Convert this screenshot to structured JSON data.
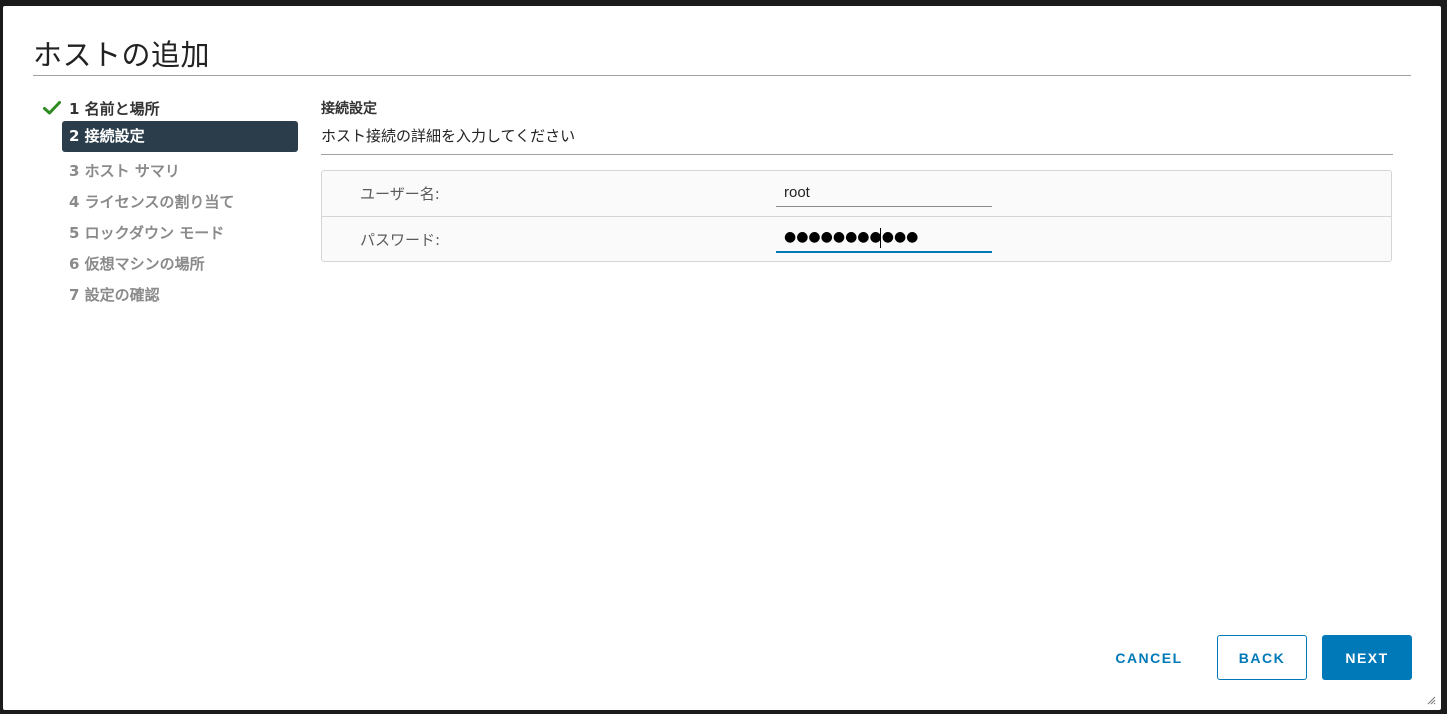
{
  "dialog": {
    "title": "ホストの追加"
  },
  "steps": [
    {
      "label": "1 名前と場所",
      "state": "done"
    },
    {
      "label": "2 接続設定",
      "state": "active"
    },
    {
      "label": "3 ホスト サマリ",
      "state": "pending"
    },
    {
      "label": "4 ライセンスの割り当て",
      "state": "pending"
    },
    {
      "label": "5 ロックダウン モード",
      "state": "pending"
    },
    {
      "label": "6 仮想マシンの場所",
      "state": "pending"
    },
    {
      "label": "7 設定の確認",
      "state": "pending"
    }
  ],
  "content": {
    "section_title": "接続設定",
    "section_desc": "ホスト接続の詳細を入力してください",
    "username_label": "ユーザー名:",
    "username_value": "root",
    "password_label": "パスワード:",
    "password_masked": "●●●●●●●●●●●"
  },
  "footer": {
    "cancel_label": "CANCEL",
    "back_label": "BACK",
    "next_label": "NEXT"
  },
  "colors": {
    "accent": "#0079b8",
    "active_step_bg": "#2b3d4a",
    "check": "#2e8b22"
  },
  "icons": {
    "done_step": "checkmark-icon",
    "resize": "resize-grip-icon"
  }
}
